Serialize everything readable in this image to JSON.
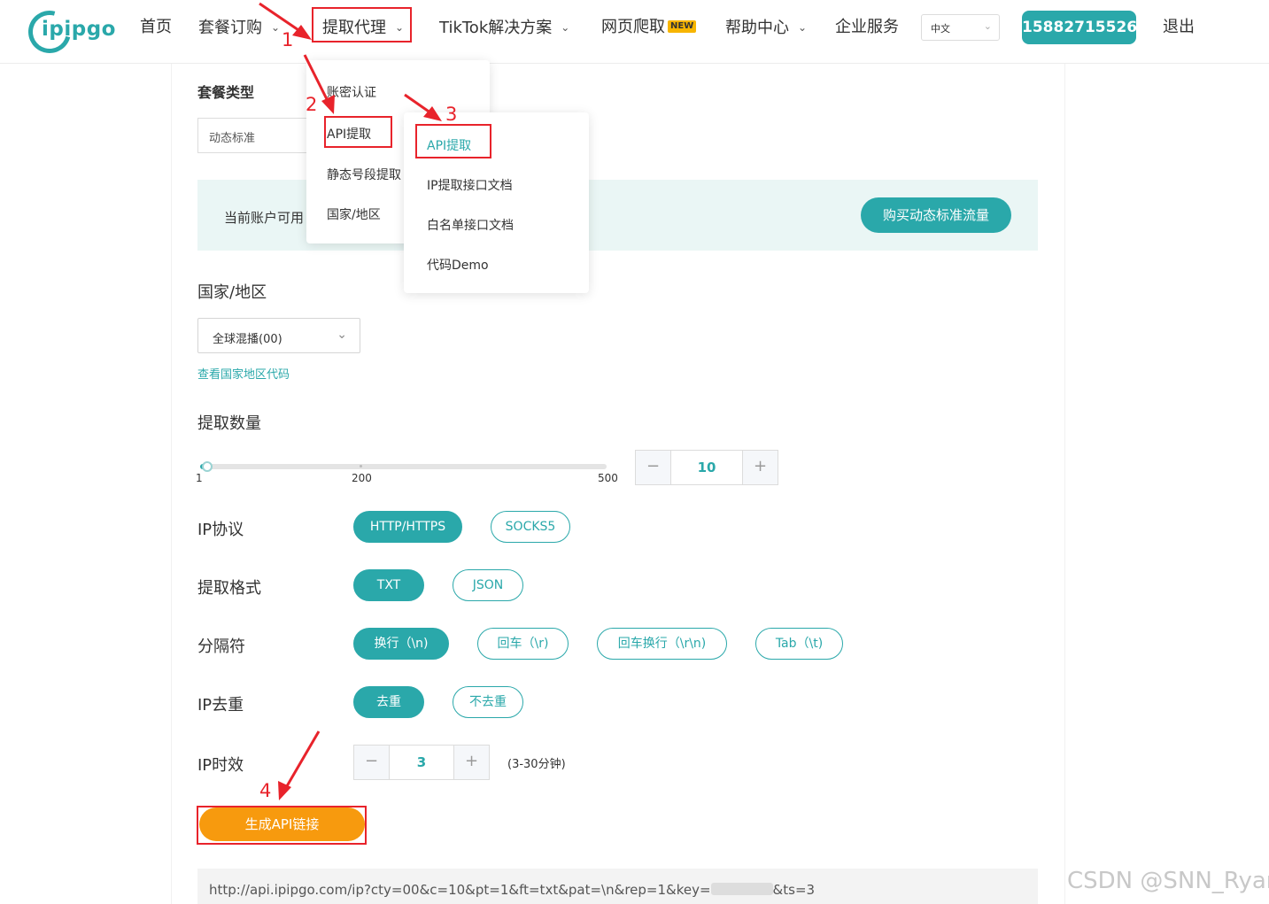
{
  "header": {
    "logo_text": "ipipgo",
    "nav": [
      {
        "label": "首页"
      },
      {
        "label": "套餐订购"
      },
      {
        "label": "提取代理"
      },
      {
        "label": "TikTok解决方案"
      },
      {
        "label": "网页爬取",
        "badge": "NEW"
      },
      {
        "label": "帮助中心"
      },
      {
        "label": "企业服务"
      }
    ],
    "language": "中文",
    "phone": "15882715526",
    "logout": "退出"
  },
  "menu_level1": [
    "账密认证",
    "API提取",
    "静态号段提取",
    "国家/地区"
  ],
  "menu_level2": [
    "API提取",
    "IP提取接口文档",
    "白名单接口文档",
    "代码Demo"
  ],
  "form": {
    "package_type_label": "套餐类型",
    "package_type_value": "动态标准",
    "balance_text": "当前账户可用",
    "buy_button": "购买动态标准流量",
    "country_label": "国家/地区",
    "country_value": "全球混播(00)",
    "country_code_link": "查看国家地区代码",
    "quantity_label": "提取数量",
    "slider_ticks": [
      "1",
      "200",
      "500"
    ],
    "slider_min": 1,
    "slider_max": 500,
    "quantity_value": "10",
    "protocol_label": "IP协议",
    "protocol_options": [
      "HTTP/HTTPS",
      "SOCKS5"
    ],
    "format_label": "提取格式",
    "format_options": [
      "TXT",
      "JSON"
    ],
    "separator_label": "分隔符",
    "separator_options": [
      "换行（\\n)",
      "回车（\\r)",
      "回车换行（\\r\\n)",
      "Tab（\\t)"
    ],
    "dedup_label": "IP去重",
    "dedup_options": [
      "去重",
      "不去重"
    ],
    "validity_label": "IP时效",
    "validity_value": "3",
    "validity_hint": "(3-30分钟)",
    "generate_button": "生成API链接",
    "api_url_prefix": "http://api.ipipgo.com/ip?cty=00&c=10&pt=1&ft=txt&pat=\\n&rep=1&key=",
    "api_url_suffix": "&ts=3"
  },
  "annotations": [
    "1",
    "2",
    "3",
    "4"
  ],
  "colors": {
    "accent": "#2aa8aa",
    "orange": "#f79a0e",
    "annotation_red": "#e8232b"
  },
  "watermark": "CSDN @SNN_Ryan"
}
